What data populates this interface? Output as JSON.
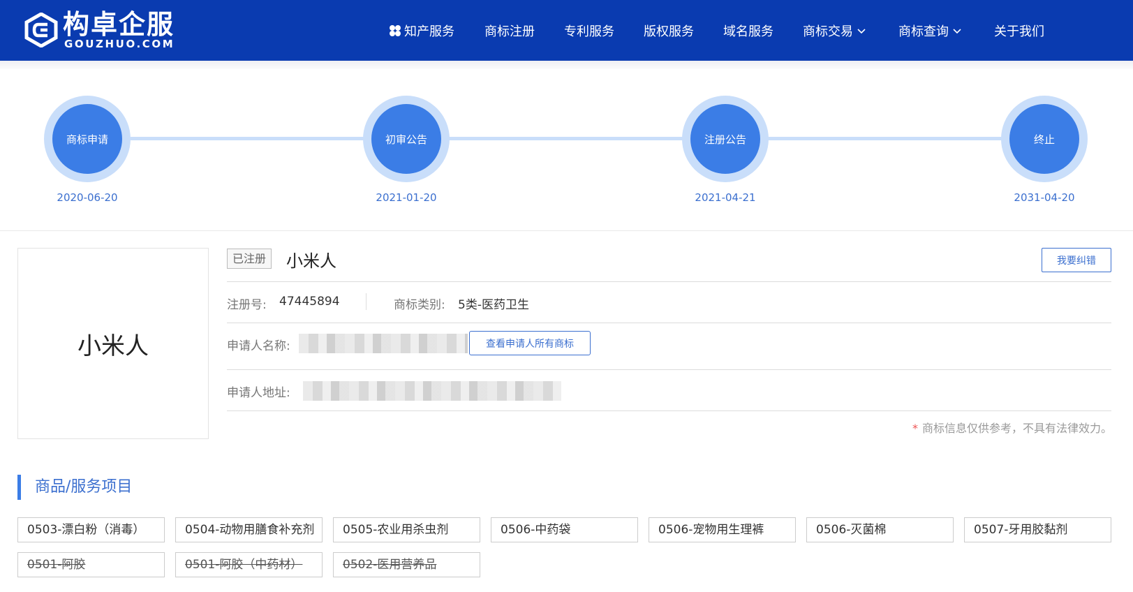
{
  "header": {
    "logo_cn": "构卓企服",
    "logo_en": "GOUZHUO.COM",
    "nav": [
      {
        "label": "知产服务"
      },
      {
        "label": "商标注册"
      },
      {
        "label": "专利服务"
      },
      {
        "label": "版权服务"
      },
      {
        "label": "域名服务"
      },
      {
        "label": "商标交易"
      },
      {
        "label": "商标查询"
      },
      {
        "label": "关于我们"
      }
    ]
  },
  "timeline": [
    {
      "label": "商标申请",
      "date": "2020-06-20"
    },
    {
      "label": "初审公告",
      "date": "2021-01-20"
    },
    {
      "label": "注册公告",
      "date": "2021-04-21"
    },
    {
      "label": "终止",
      "date": "2031-04-20"
    }
  ],
  "trademark": {
    "thumb_text": "小米人",
    "status": "已注册",
    "name": "小米人",
    "report_label": "我要纠错",
    "reg_no_label": "注册号:",
    "reg_no": "47445894",
    "category_label": "商标类别:",
    "category": "5类-医药卫生",
    "applicant_label": "申请人名称:",
    "view_all_label": "查看申请人所有商标",
    "address_label": "申请人地址:",
    "disclaimer_star": "*",
    "disclaimer": "商标信息仅供参考，不具有法律效力。"
  },
  "goods": {
    "title": "商品/服务项目",
    "items": [
      {
        "text": "0503-漂白粉（消毒）",
        "struck": false
      },
      {
        "text": "0504-动物用膳食补充剂",
        "struck": false
      },
      {
        "text": "0505-农业用杀虫剂",
        "struck": false
      },
      {
        "text": "0506-中药袋",
        "struck": false
      },
      {
        "text": "0506-宠物用生理裤",
        "struck": false
      },
      {
        "text": "0506-灭菌棉",
        "struck": false
      },
      {
        "text": "0507-牙用胶黏剂",
        "struck": false
      },
      {
        "text": "0501-阿胶",
        "struck": true
      },
      {
        "text": "0501-阿胶（中药材）",
        "struck": true
      },
      {
        "text": "0502-医用营养品",
        "struck": true
      }
    ]
  }
}
